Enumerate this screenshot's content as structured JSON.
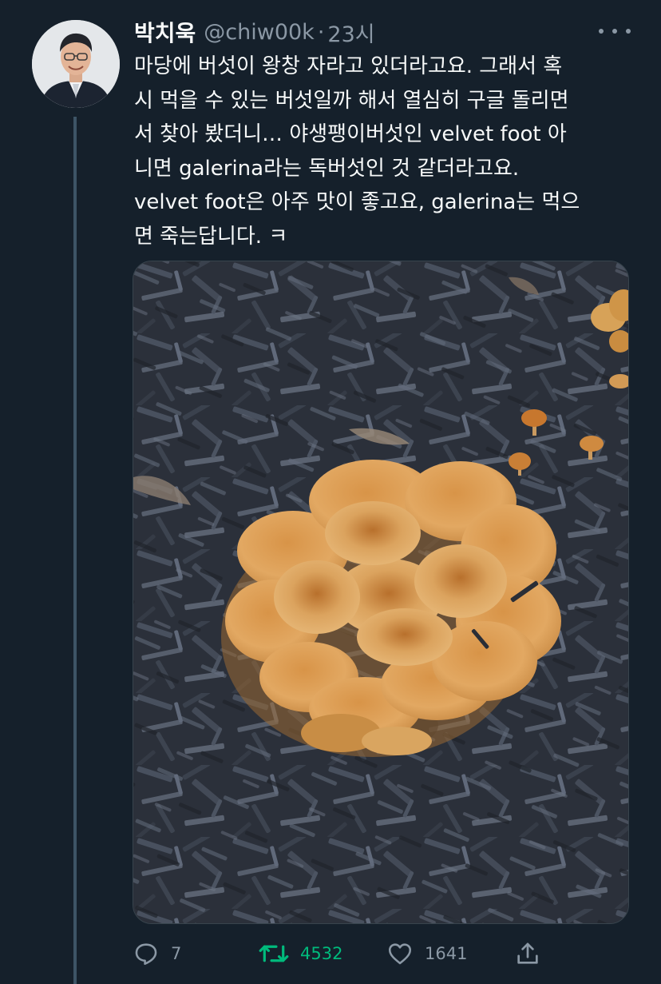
{
  "author": {
    "display_name": "박치욱",
    "handle": "@chiw00k",
    "separator": "·",
    "timestamp": "23시",
    "avatar_icon": "user-avatar-photo"
  },
  "tweet": {
    "text_lines": [
      "마당에 버섯이 왕창 자라고 있더라고요. 그래서 혹",
      "시 먹을 수 있는 버섯일까 해서 열심히 구글 돌리면",
      "서 찾아 봤더니… 야생팽이버섯인 velvet foot 아",
      "니면 galerina라는 독버섯인 것 같더라고요.",
      "velvet foot은 아주 맛이 좋고요, galerina는 먹으",
      "면 죽는답니다. ㅋ"
    ],
    "media_description_icon": "mushroom-photo"
  },
  "actions": {
    "reply": {
      "icon": "reply-icon",
      "count": "7"
    },
    "retweet": {
      "icon": "retweet-icon",
      "count": "4532",
      "color": "#00ba7c"
    },
    "like": {
      "icon": "heart-icon",
      "count": "1641"
    },
    "share": {
      "icon": "share-icon"
    }
  },
  "colors": {
    "background": "#15202b",
    "text_primary": "#f7f9f9",
    "text_secondary": "#8b98a5",
    "retweet_green": "#00ba7c",
    "thread_line": "#3d5466"
  }
}
